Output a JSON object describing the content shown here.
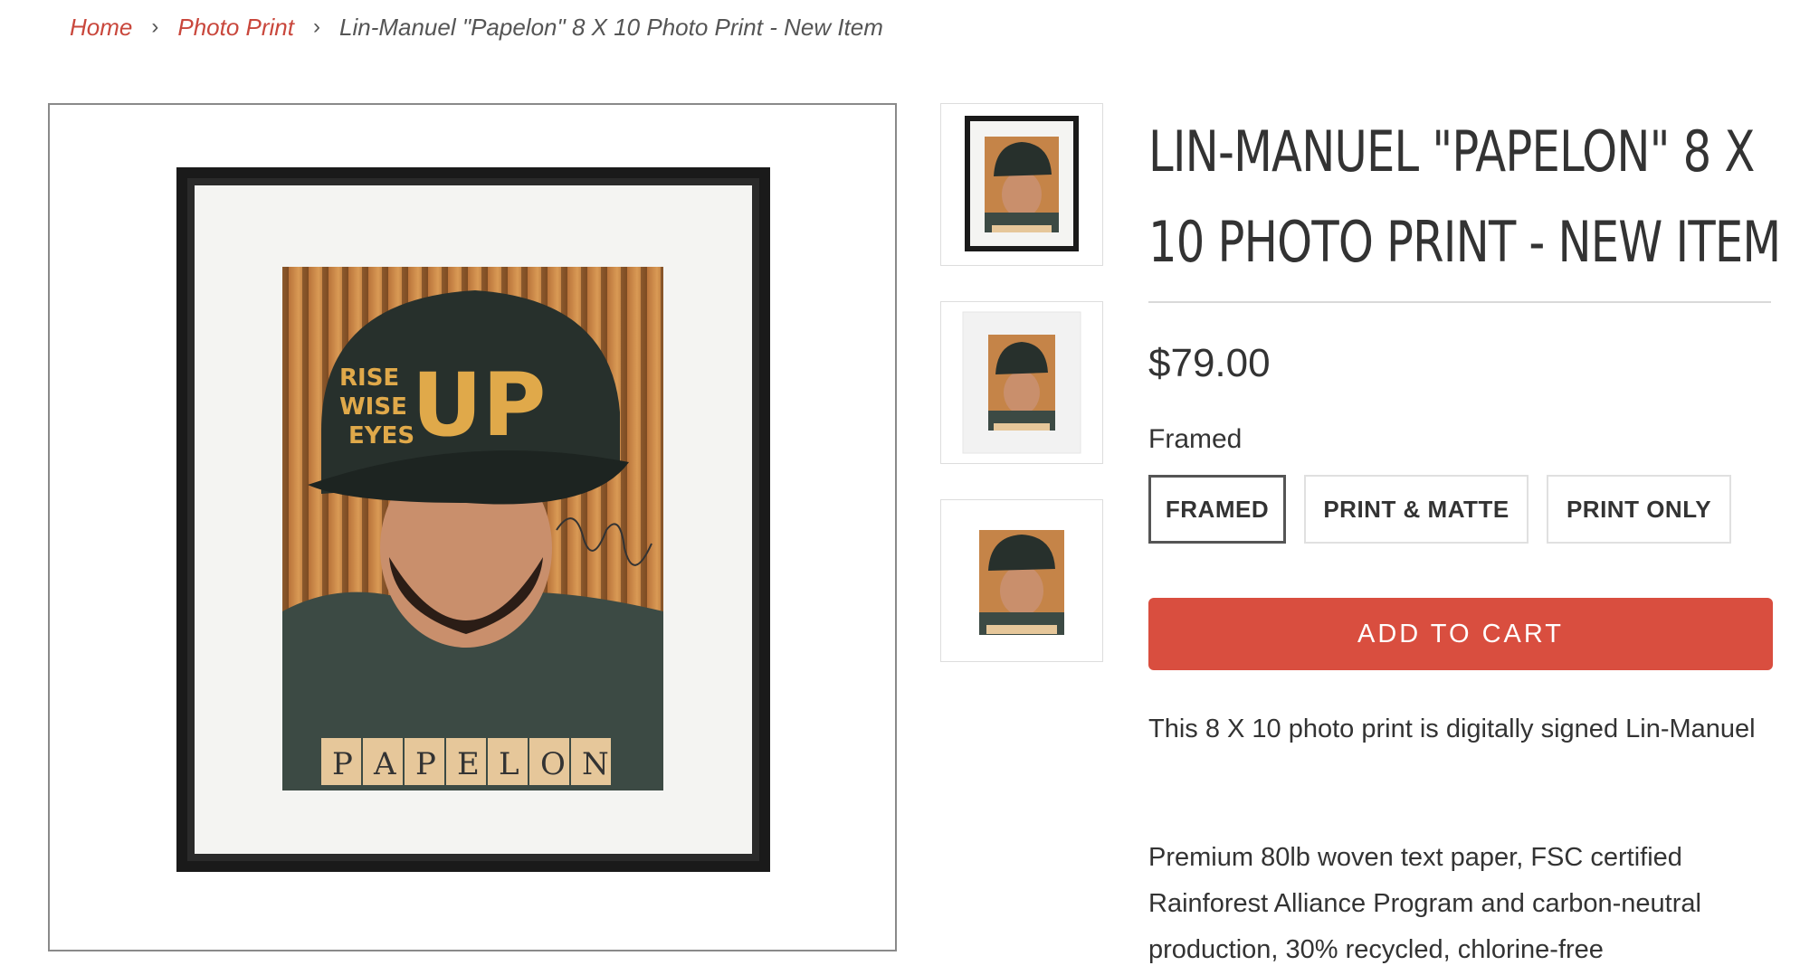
{
  "breadcrumb": {
    "home": "Home",
    "separator": "›",
    "category": "Photo Print",
    "current": "Lin-Manuel \"Papelon\" 8 X 10 Photo Print - New Item"
  },
  "product": {
    "title": "LIN-MANUEL \"PAPELON\" 8 X 10 PHOTO PRINT - NEW ITEM",
    "price": "$79.00",
    "option_label": "Framed",
    "options": [
      "FRAMED",
      "PRINT & MATTE",
      "PRINT ONLY"
    ],
    "selected_option": "FRAMED",
    "add_to_cart": "ADD TO CART",
    "description_1": "This 8 X 10 photo print is digitally signed Lin-Manuel",
    "description_2": "Premium 80lb woven text paper, FSC certified Rainforest Alliance Program and carbon-neutral production, 30% recycled, chlorine-free"
  },
  "photo": {
    "cap_text_1": "RISE",
    "cap_text_2": "WISE",
    "cap_text_3": "EYES",
    "cap_text_big": "UP",
    "tiles": [
      "P",
      "A",
      "P",
      "E",
      "L",
      "O",
      "N"
    ]
  },
  "colors": {
    "accent": "#d94e3f",
    "link": "#c9473c",
    "frame": "#1a1a1a",
    "mat": "#f4f4f2"
  }
}
